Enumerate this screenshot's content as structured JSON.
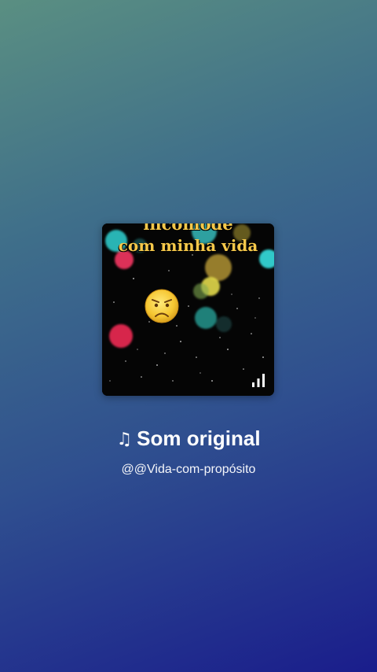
{
  "cover": {
    "text_top": "incomode",
    "text_main": "com minha vida",
    "emoji_icon": "frowning-face-emoji",
    "signal_icon": "signal-bars-icon",
    "text_color": "#f5c84a"
  },
  "sound": {
    "note_icon": "♫",
    "title": "Som original",
    "author": "@@Vida-com-propósito"
  },
  "colors": {
    "background_top": "#5a8f82",
    "background_bottom": "#1a1d8c"
  }
}
